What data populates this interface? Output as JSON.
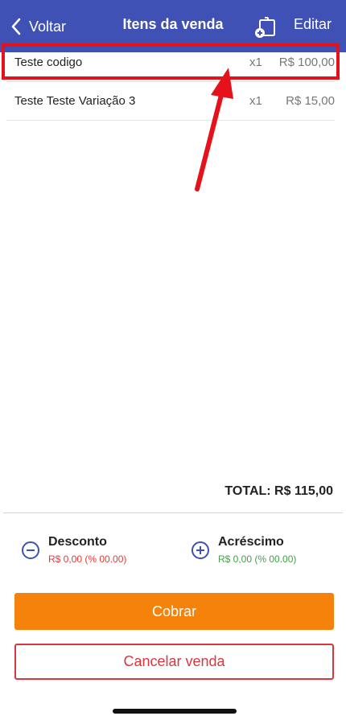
{
  "nav": {
    "back_label": "Voltar",
    "title": "Itens da venda",
    "edit_label": "Editar",
    "bag_icon": "bag-plus-icon",
    "color": "#3f51b5"
  },
  "items": [
    {
      "name": "Teste codigo",
      "qty": "x1",
      "price": "R$ 100,00"
    },
    {
      "name": "Teste Teste Variação 3",
      "qty": "x1",
      "price": "R$ 15,00"
    }
  ],
  "total": "TOTAL: R$ 115,00",
  "discount": {
    "label": "Desconto",
    "value": "R$ 0,00 (% 00.00)",
    "color": "#e53935",
    "icon": "minus-circle-icon"
  },
  "surcharge": {
    "label": "Acréscimo",
    "value": "R$ 0,00 (% 00.00)",
    "color": "#43a047",
    "icon": "plus-circle-icon"
  },
  "actions": {
    "charge_label": "Cobrar",
    "cancel_label": "Cancelar venda"
  },
  "annotation": {
    "color": "#e5121b"
  }
}
